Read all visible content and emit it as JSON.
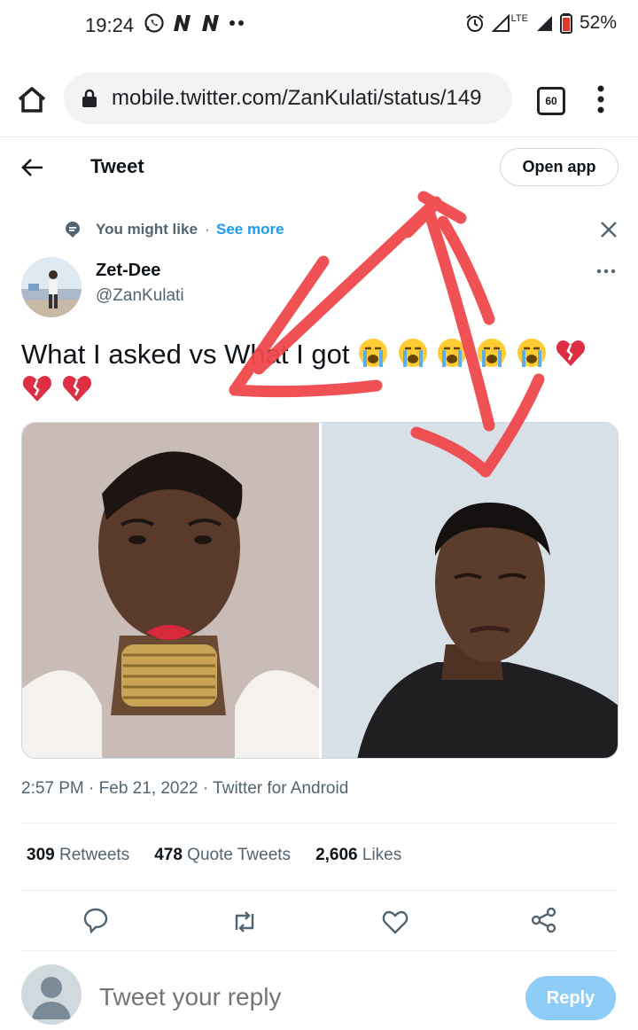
{
  "status_bar": {
    "time": "19:24",
    "battery": "52%",
    "network": "LTE",
    "icons": [
      "whatsapp-icon",
      "n-app-icon",
      "n-app-icon",
      "more-dots-icon",
      "alarm-icon",
      "signal-icon",
      "signal-icon",
      "battery-icon"
    ]
  },
  "browser": {
    "url": "mobile.twitter.com/ZanKulati/status/149",
    "tab_count": "60"
  },
  "header": {
    "title": "Tweet",
    "open_app": "Open app"
  },
  "suggestion": {
    "label": "You might like",
    "separator": "·",
    "see_more": "See more"
  },
  "author": {
    "name": "Zet-Dee",
    "handle": "@ZanKulati"
  },
  "tweet": {
    "text": "What I asked vs What I got",
    "emojis_line1": [
      "loudly-crying-face",
      "loudly-crying-face",
      "loudly-crying-face",
      "loudly-crying-face",
      "loudly-crying-face",
      "broken-heart"
    ],
    "emojis_line2": [
      "broken-heart",
      "broken-heart"
    ],
    "timestamp": "2:57 PM · Feb 21, 2022 · Twitter for Android"
  },
  "stats": {
    "retweets_count": "309",
    "retweets_label": "Retweets",
    "quotes_count": "478",
    "quotes_label": "Quote Tweets",
    "likes_count": "2,606",
    "likes_label": "Likes"
  },
  "actions": [
    "reply-icon",
    "retweet-icon",
    "like-icon",
    "share-icon"
  ],
  "reply": {
    "placeholder": "Tweet your reply",
    "button": "Reply"
  },
  "colors": {
    "accent": "#1d9bf0",
    "reply_button": "#8ecdf8",
    "secondary_text": "#536471",
    "annotation_red": "#f0484c"
  }
}
